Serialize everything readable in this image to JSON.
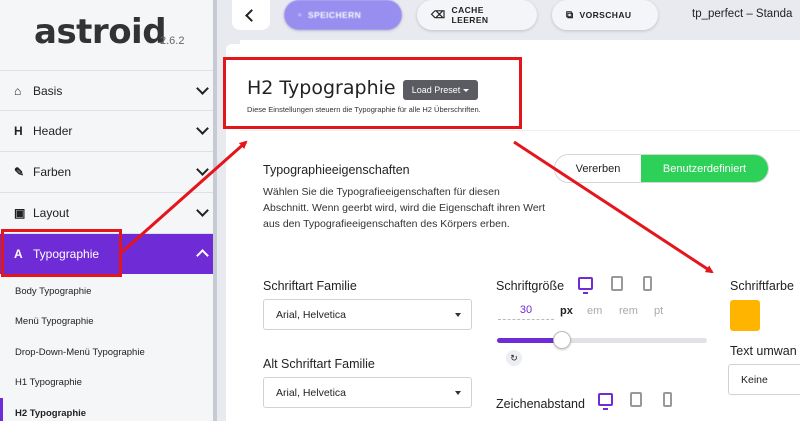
{
  "sidebar": {
    "logo": "astroid",
    "version": "2.6.2",
    "items": [
      {
        "label": "Basis",
        "icon": "home-icon"
      },
      {
        "label": "Header",
        "icon": "heading-icon"
      },
      {
        "label": "Farben",
        "icon": "brush-icon"
      },
      {
        "label": "Layout",
        "icon": "layout-icon"
      },
      {
        "label": "Typographie",
        "icon": "font-icon"
      }
    ],
    "sub_items": [
      "Body Typographie",
      "Menü Typographie",
      "Drop-Down-Menü Typographie",
      "H1 Typographie",
      "H2 Typographie"
    ]
  },
  "toolbar": {
    "save_label": "SPEICHERN",
    "cache_label": "CACHE LEEREN",
    "preview_label": "VORSCHAU",
    "template_title": "tp_perfect – Standa"
  },
  "section": {
    "title": "H2 Typographie",
    "preset_label": "Load Preset",
    "description": "Diese Einstellungen steuern die Typographie für alle H2 Überschriften."
  },
  "properties": {
    "title": "Typographieeigenschaften",
    "description": "Wählen Sie die Typografieeigenschaften für diesen Abschnitt. Wenn geerbt wird, wird die Eigenschaft ihren Wert aus den Typografieeigenschaften des Körpers erben.",
    "toggle_inherit": "Vererben",
    "toggle_custom": "Benutzerdefiniert"
  },
  "fields": {
    "font_family_label": "Schriftart Familie",
    "font_family_value": "Arial, Helvetica",
    "alt_font_family_label": "Alt Schriftart Familie",
    "alt_font_family_value": "Arial, Helvetica",
    "font_size_label": "Schriftgröße",
    "font_size_value": "30",
    "units": [
      "px",
      "em",
      "rem",
      "pt"
    ],
    "selected_unit": "px",
    "slider_fraction": 0.31,
    "letter_spacing_label": "Zeichenabstand",
    "font_color_label": "Schriftfarbe",
    "font_color_value": "#ffb400",
    "text_transform_label": "Text umwan",
    "text_transform_value": "Keine"
  },
  "colors": {
    "accent": "#6f2bd6",
    "toggle_active": "#2ed158",
    "highlight": "#e4161c"
  }
}
